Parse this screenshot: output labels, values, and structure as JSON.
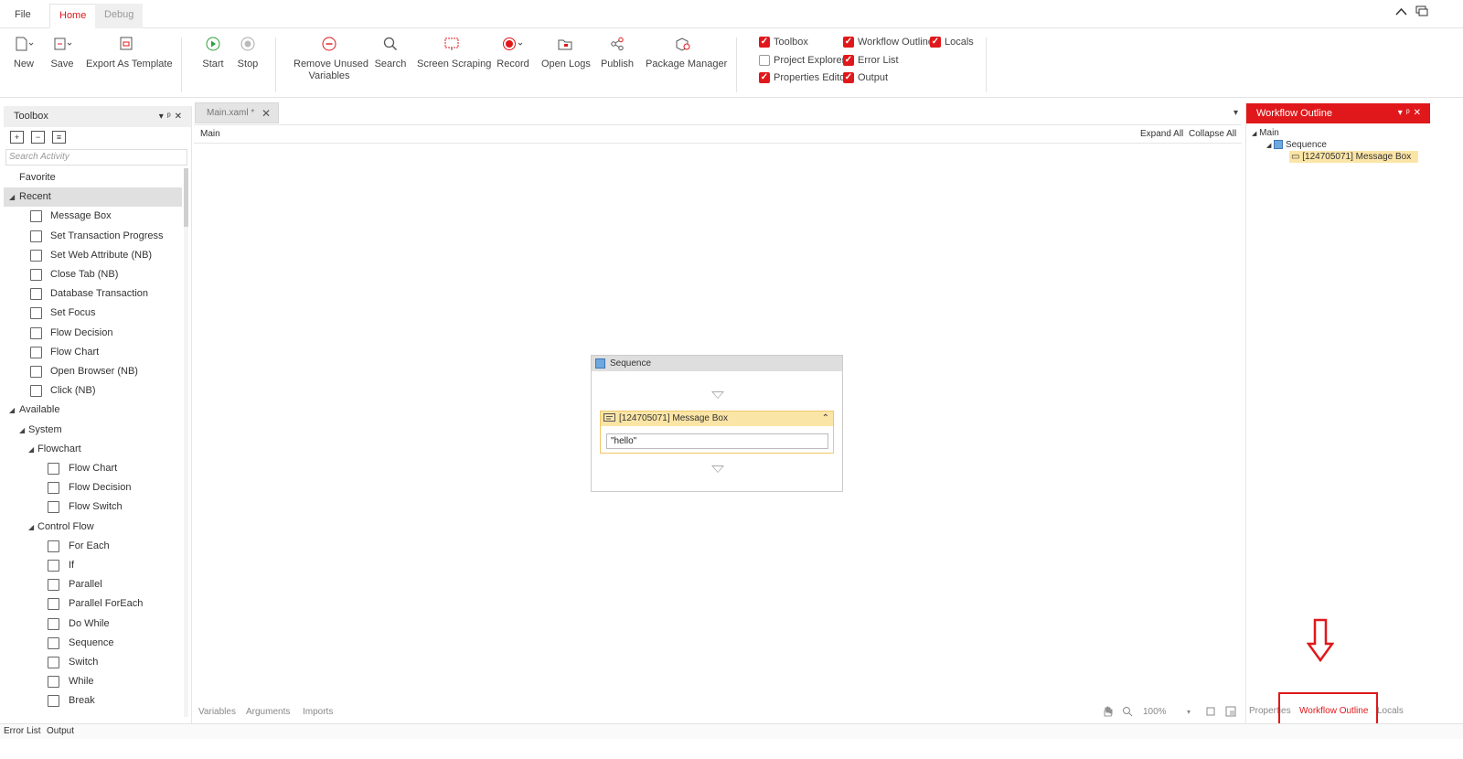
{
  "menu": {
    "tabs": [
      {
        "label": "File"
      },
      {
        "label": "Home"
      },
      {
        "label": "Debug"
      }
    ],
    "window": {
      "collapse_icon": "chevron-up-icon",
      "feedback_icon": "feedback-icon"
    }
  },
  "ribbon": {
    "new": "New",
    "save": "Save",
    "export_template": "Export As Template",
    "start": "Start",
    "stop": "Stop",
    "remove_unused_line1": "Remove Unused",
    "remove_unused_line2": "Variables",
    "search": "Search",
    "screen_scraping": "Screen Scraping",
    "record": "Record",
    "open_logs": "Open Logs",
    "publish": "Publish",
    "package_manager": "Package Manager",
    "checks": {
      "toolbox": {
        "label": "Toolbox",
        "checked": true
      },
      "project_explorer": {
        "label": "Project Explorer",
        "checked": false
      },
      "properties_editor": {
        "label": "Properties Editor",
        "checked": true
      },
      "workflow_outline": {
        "label": "Workflow Outline",
        "checked": true
      },
      "error_list": {
        "label": "Error List",
        "checked": true
      },
      "output": {
        "label": "Output",
        "checked": true
      },
      "locals": {
        "label": "Locals",
        "checked": true
      }
    }
  },
  "toolbox": {
    "title": "Toolbox",
    "search_placeholder": "Search Activity",
    "favorite": "Favorite",
    "recent": "Recent",
    "recent_items": [
      "Message Box",
      "Set Transaction Progress",
      "Set Web Attribute (NB)",
      "Close Tab (NB)",
      "Database Transaction",
      "Set Focus",
      "Flow Decision",
      "Flow Chart",
      "Open Browser (NB)",
      "Click (NB)"
    ],
    "available": "Available",
    "system": "System",
    "flowchart": "Flowchart",
    "flowchart_items": [
      "Flow Chart",
      "Flow Decision",
      "Flow Switch"
    ],
    "control_flow": "Control Flow",
    "control_flow_items": [
      "For Each",
      "If",
      "Parallel",
      "Parallel ForEach",
      "Do While",
      "Sequence",
      "Switch",
      "While",
      "Break"
    ]
  },
  "designer": {
    "doc_tab": "Main.xaml *",
    "breadcrumb": "Main",
    "expand_all": "Expand All",
    "collapse_all": "Collapse All",
    "sequence_title": "Sequence",
    "message_box_title": "[124705071] Message Box",
    "message_value": "\"hello\"",
    "variables": "Variables",
    "arguments": "Arguments",
    "imports": "Imports",
    "zoom": "100%"
  },
  "outline": {
    "title": "Workflow Outline",
    "root": "Main",
    "sequence": "Sequence",
    "message_box": "[124705071] Message Box"
  },
  "right_tabs": {
    "properties": "Properties",
    "workflow_outline": "Workflow Outline",
    "locals": "Locals"
  },
  "status": {
    "error_list": "Error List",
    "output": "Output"
  },
  "colors": {
    "accent": "#e0181b",
    "selection": "#fbe5a6"
  }
}
